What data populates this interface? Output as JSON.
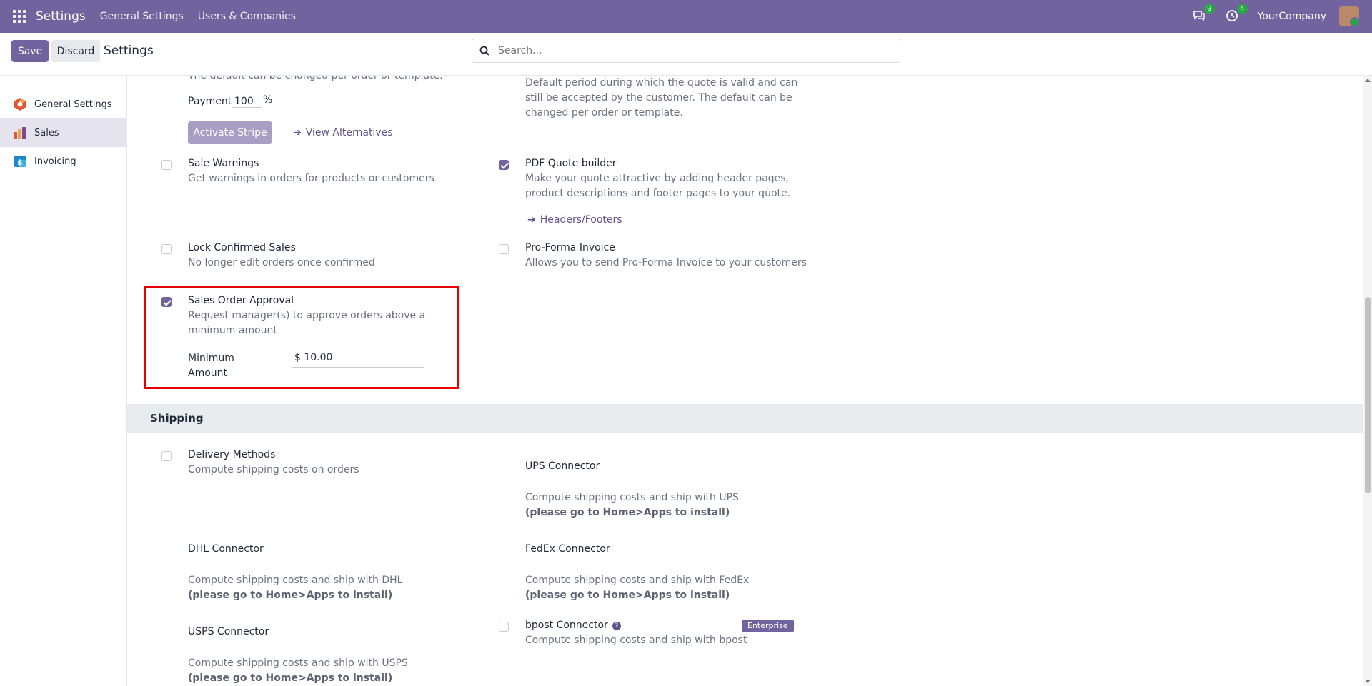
{
  "navbar": {
    "brand": "Settings",
    "menu": [
      "General Settings",
      "Users & Companies"
    ],
    "messages_count": "9",
    "activities_count": "4",
    "company": "YourCompany"
  },
  "control": {
    "save_label": "Save",
    "discard_label": "Discard",
    "title": "Settings",
    "search_placeholder": "Search..."
  },
  "sidebar": {
    "items": [
      {
        "label": "General Settings",
        "icon": "general-settings-icon"
      },
      {
        "label": "Sales",
        "icon": "sales-icon"
      },
      {
        "label": "Invoicing",
        "icon": "invoicing-icon"
      }
    ]
  },
  "payment": {
    "top_cutoff": "The default can be changed per order or template.",
    "label": "Payment",
    "value": "100",
    "unit": "%",
    "activate_stripe": "Activate Stripe",
    "view_alternatives": "View Alternatives"
  },
  "quotation_validity": {
    "desc": "Default period during which the quote is valid and can still be accepted by the customer. The default can be changed per order or template."
  },
  "sale_warnings": {
    "title": "Sale Warnings",
    "desc": "Get warnings in orders for products or customers",
    "checked": false
  },
  "pdf_quote": {
    "title": "PDF Quote builder",
    "desc": "Make your quote attractive by adding header pages, product descriptions and footer pages to your quote.",
    "link": "Headers/Footers",
    "checked": true
  },
  "lock_sales": {
    "title": "Lock Confirmed Sales",
    "desc": "No longer edit orders once confirmed",
    "checked": false
  },
  "proforma": {
    "title": "Pro-Forma Invoice",
    "desc": "Allows you to send Pro-Forma Invoice to your customers",
    "checked": false
  },
  "approval": {
    "title": "Sales Order Approval",
    "desc": "Request manager(s) to approve orders above a minimum amount",
    "min_label_1": "Minimum",
    "min_label_2": "Amount",
    "min_value": "$ 10.00",
    "checked": true
  },
  "shipping": {
    "section_title": "Shipping",
    "delivery": {
      "title": "Delivery Methods",
      "desc": "Compute shipping costs on orders"
    },
    "ups": {
      "title": "UPS Connector",
      "desc": "Compute shipping costs and ship with UPS",
      "note": "(please go to Home>Apps to install)"
    },
    "dhl": {
      "title": "DHL Connector",
      "desc": "Compute shipping costs and ship with DHL",
      "note": "(please go to Home>Apps to install)"
    },
    "fedex": {
      "title": "FedEx Connector",
      "desc": "Compute shipping costs and ship with FedEx",
      "note": "(please go to Home>Apps to install)"
    },
    "usps": {
      "title": "USPS Connector",
      "desc": "Compute shipping costs and ship with USPS",
      "note": "(please go to Home>Apps to install)"
    },
    "bpost": {
      "title": "bpost Connector",
      "desc": "Compute shipping costs and ship with bpost",
      "badge": "Enterprise"
    }
  },
  "colors": {
    "primary": "#71639e",
    "highlight": "#e60000"
  }
}
